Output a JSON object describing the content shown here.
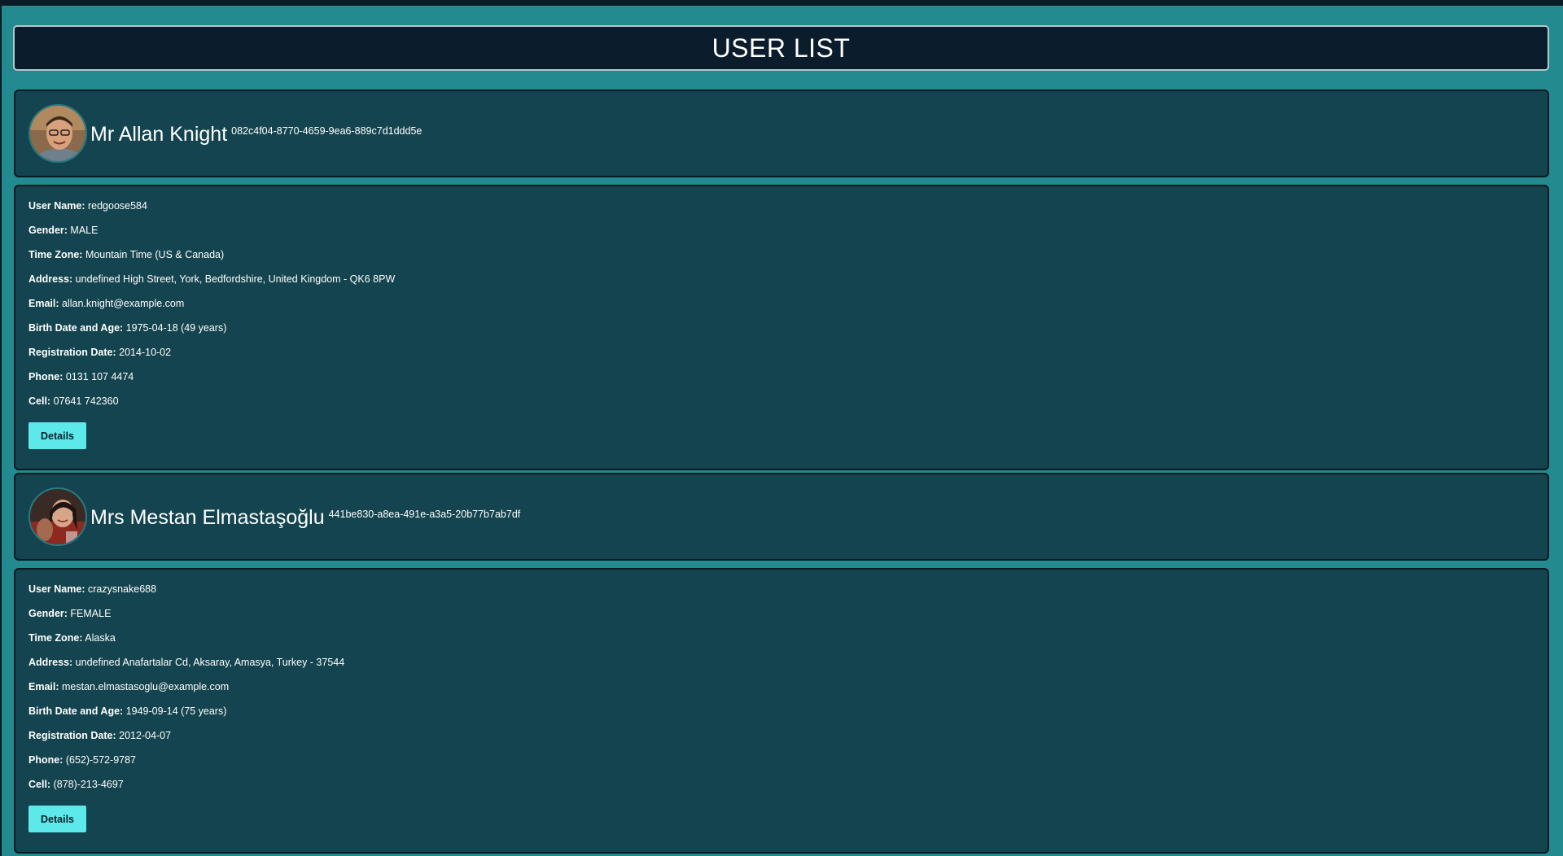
{
  "header": {
    "title": "USER LIST"
  },
  "users": [
    {
      "name": "Mr Allan Knight",
      "id": "082c4f04-8770-4659-9ea6-889c7d1ddd5e",
      "labels": {
        "username": "User Name:",
        "gender": "Gender:",
        "timezone": "Time Zone:",
        "address": "Address:",
        "email": "Email:",
        "birth": "Birth Date and Age:",
        "registration": "Registration Date:",
        "phone": "Phone:",
        "cell": "Cell:"
      },
      "username": "redgoose584",
      "gender": "MALE",
      "timezone": "Mountain Time (US & Canada)",
      "address": "undefined High Street, York, Bedfordshire, United Kingdom - QK6 8PW",
      "email": "allan.knight@example.com",
      "birth": "1975-04-18 (49 years)",
      "registration": "2014-10-02",
      "phone": "0131 107 4474",
      "cell": "07641 742360",
      "button": "Details"
    },
    {
      "name": "Mrs Mestan Elmastaşoğlu",
      "id": "441be830-a8ea-491e-a3a5-20b77b7ab7df",
      "labels": {
        "username": "User Name:",
        "gender": "Gender:",
        "timezone": "Time Zone:",
        "address": "Address:",
        "email": "Email:",
        "birth": "Birth Date and Age:",
        "registration": "Registration Date:",
        "phone": "Phone:",
        "cell": "Cell:"
      },
      "username": "crazysnake688",
      "gender": "FEMALE",
      "timezone": "Alaska",
      "address": "undefined Anafartalar Cd, Aksaray, Amasya, Turkey - 37544",
      "email": "mestan.elmastasoglu@example.com",
      "birth": "1949-09-14 (75 years)",
      "registration": "2012-04-07",
      "phone": "(652)-572-9787",
      "cell": "(878)-213-4697",
      "button": "Details"
    }
  ]
}
